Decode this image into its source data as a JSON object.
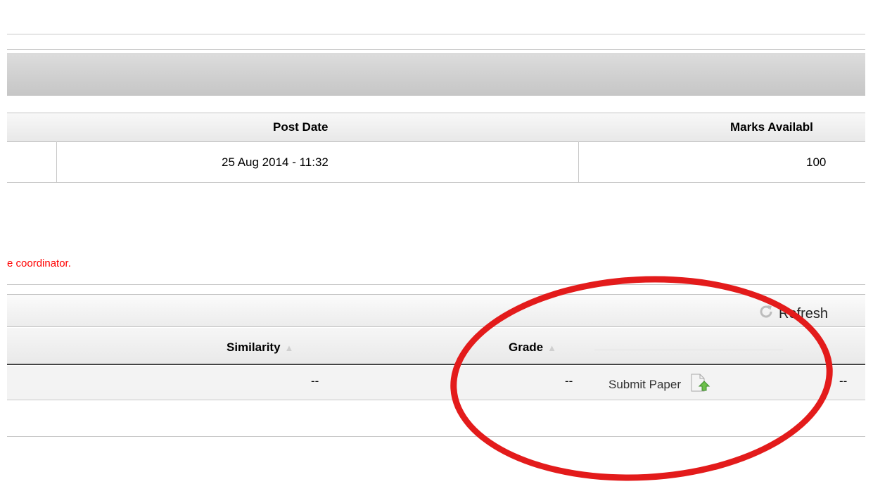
{
  "assignment_info": {
    "headers": {
      "post_date": "Post Date",
      "marks_available": "Marks Availabl"
    },
    "row": {
      "post_date": "25 Aug 2014 - 11:32",
      "marks_available": "100"
    }
  },
  "notice": {
    "text": "e coordinator.",
    "color": "#ff0000"
  },
  "submission_toolbar": {
    "refresh_label": "Refresh",
    "refresh_icon": "refresh-icon"
  },
  "submission_table": {
    "headers": {
      "similarity": "Similarity",
      "grade": "Grade"
    },
    "row": {
      "similarity": "--",
      "grade": "--",
      "submit_label": "Submit Paper",
      "submit_icon": "upload-file-icon",
      "trailing": "--"
    }
  },
  "annotation": {
    "shape": "circle",
    "color": "#e31b1b"
  }
}
